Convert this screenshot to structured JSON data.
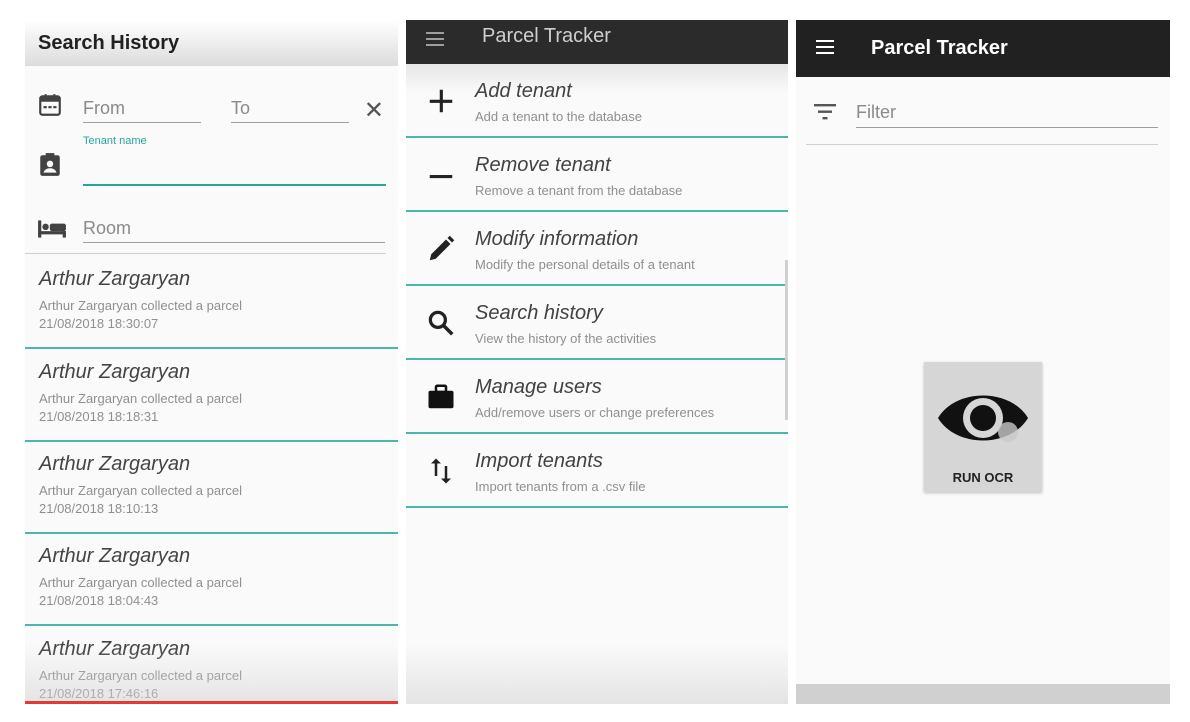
{
  "search_history": {
    "title": "Search History",
    "from_placeholder": "From",
    "to_placeholder": "To",
    "tenant_label": "Tenant name",
    "room_placeholder": "Room",
    "items": [
      {
        "name": "Arthur Zargaryan",
        "desc": "Arthur Zargaryan collected a parcel",
        "time": "21/08/2018 18:30:07"
      },
      {
        "name": "Arthur Zargaryan",
        "desc": "Arthur Zargaryan collected a parcel",
        "time": "21/08/2018 18:18:31"
      },
      {
        "name": "Arthur Zargaryan",
        "desc": "Arthur Zargaryan collected a parcel",
        "time": "21/08/2018 18:10:13"
      },
      {
        "name": "Arthur Zargaryan",
        "desc": "Arthur Zargaryan collected a parcel",
        "time": "21/08/2018 18:04:43"
      },
      {
        "name": "Arthur Zargaryan",
        "desc": "Arthur Zargaryan collected a parcel",
        "time": "21/08/2018 17:46:16"
      }
    ]
  },
  "menu_screen": {
    "title": "Parcel Tracker",
    "items": [
      {
        "title": "Add tenant",
        "subtitle": "Add a tenant to the database",
        "icon": "plus-icon"
      },
      {
        "title": "Remove tenant",
        "subtitle": "Remove a tenant from the database",
        "icon": "minus-icon"
      },
      {
        "title": "Modify information",
        "subtitle": "Modify the personal details of a tenant",
        "icon": "pencil-icon"
      },
      {
        "title": "Search history",
        "subtitle": "View the history of the activities",
        "icon": "search-icon"
      },
      {
        "title": "Manage users",
        "subtitle": "Add/remove users or change preferences",
        "icon": "briefcase-icon"
      },
      {
        "title": "Import tenants",
        "subtitle": "Import tenants from a .csv file",
        "icon": "import-arrows-icon"
      }
    ]
  },
  "ocr_screen": {
    "title": "Parcel Tracker",
    "filter_placeholder": "Filter",
    "ocr_button_label": "RUN OCR"
  },
  "colors": {
    "accent": "#26a69a",
    "divider": "#4db6ac",
    "toolbar_dark": "#212121"
  }
}
